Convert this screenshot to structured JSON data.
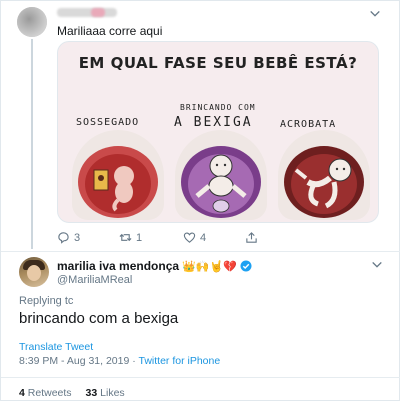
{
  "parent_tweet": {
    "text": "Mariliaaa corre aqui",
    "media": {
      "title": "EM QUAL FASE SEU BEBÊ ESTÁ?",
      "panels": [
        {
          "label": "SOSSEGADO"
        },
        {
          "label_top": "BRINCANDO COM",
          "label": "A BEXIGA"
        },
        {
          "label": "ACROBATA"
        }
      ]
    },
    "actions": {
      "reply_count": "3",
      "retweet_count": "1",
      "like_count": "4"
    }
  },
  "tweet": {
    "name": "marilia iva mendonça",
    "name_emojis": "👑🙌🤘💔",
    "handle": "@MariliaMReal",
    "replying_to": "Replying tc",
    "text": "brincando com a bexiga",
    "translate_label": "Translate Tweet",
    "timestamp": "8:39 PM - Aug 31, 2019",
    "separator": " · ",
    "source": "Twitter for iPhone",
    "retweets": {
      "count": "4",
      "label": "Retweets"
    },
    "likes": {
      "count": "33",
      "label": "Likes"
    }
  },
  "colors": {
    "link": "#1b95e0",
    "secondary_text": "#657786",
    "verified": "#1da1f2",
    "divider": "#e6ecf0"
  }
}
